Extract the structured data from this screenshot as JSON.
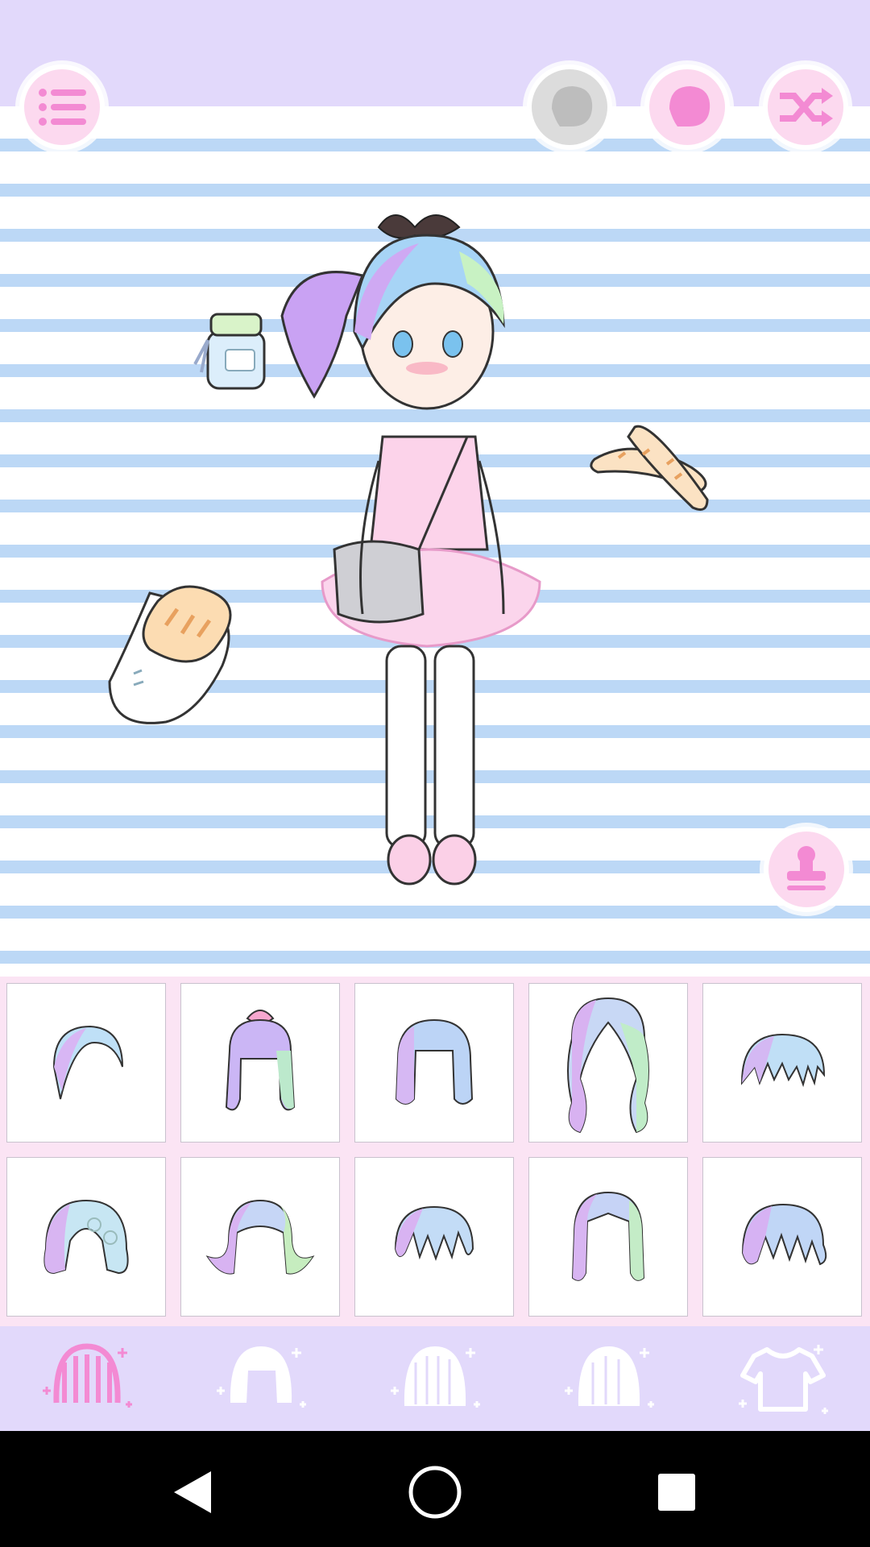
{
  "app": {
    "accent": "#f38ad3",
    "topbar_color": "#e2d9fb"
  },
  "toolbar": {
    "menu_icon": "list-icon",
    "outline_icon": "head-outline-icon",
    "head_icon": "head-icon",
    "shuffle_icon": "shuffle-icon"
  },
  "stage": {
    "items": [
      "jam-jar",
      "twin-baguettes",
      "bread-bag",
      "character"
    ],
    "save_icon": "stamp-icon"
  },
  "hair_options": [
    {
      "style": "short-side-part"
    },
    {
      "style": "bow-top"
    },
    {
      "style": "bob-bangs"
    },
    {
      "style": "long-wavy"
    },
    {
      "style": "spiky-short"
    },
    {
      "style": "curled-bob"
    },
    {
      "style": "flipped-bob"
    },
    {
      "style": "pixie"
    },
    {
      "style": "straight-bob"
    },
    {
      "style": "messy-short"
    }
  ],
  "tabs": [
    {
      "name": "bangs",
      "selected": true
    },
    {
      "name": "front-hair",
      "selected": false
    },
    {
      "name": "back-hair",
      "selected": false
    },
    {
      "name": "long-hair",
      "selected": false
    },
    {
      "name": "outfit",
      "selected": false
    }
  ],
  "navigation": [
    "back",
    "home",
    "recents"
  ]
}
